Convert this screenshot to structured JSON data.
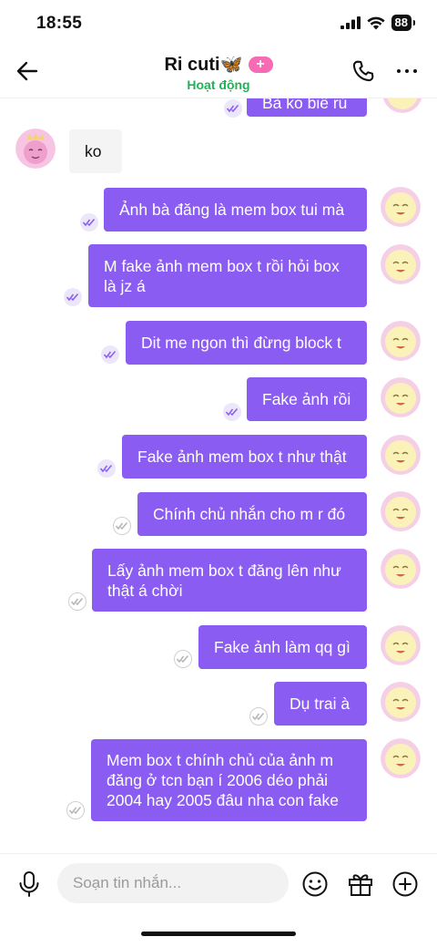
{
  "status_bar": {
    "time": "18:55",
    "battery": "88"
  },
  "header": {
    "title": "Ri cuti🦋",
    "plus_badge": "+",
    "status": "Hoạt động"
  },
  "colors": {
    "accent": "#8a5cf1",
    "online": "#20b257",
    "badge": "#f66bb4"
  },
  "messages": [
    {
      "side": "out",
      "text": "Bà ko biế rủ",
      "receipt": "seen"
    },
    {
      "side": "in",
      "text": "ko"
    },
    {
      "side": "out",
      "text": "Ảnh bà đăng là mem box tui mà",
      "receipt": "seen"
    },
    {
      "side": "out",
      "text": "M fake ảnh mem box t rồi hỏi box là jz á",
      "receipt": "seen"
    },
    {
      "side": "out",
      "text": "Dit me ngon thì đừng block t",
      "receipt": "seen"
    },
    {
      "side": "out",
      "text": "Fake ảnh rồi",
      "receipt": "seen"
    },
    {
      "side": "out",
      "text": "Fake ảnh mem box t như thật",
      "receipt": "seen"
    },
    {
      "side": "out",
      "text": "Chính chủ nhắn cho m r đó",
      "receipt": "sent"
    },
    {
      "side": "out",
      "text": "Lấy ảnh mem box t đăng lên như thật á chời",
      "receipt": "sent"
    },
    {
      "side": "out",
      "text": "Fake ảnh làm qq gì",
      "receipt": "sent"
    },
    {
      "side": "out",
      "text": "Dụ trai à",
      "receipt": "sent"
    },
    {
      "side": "out",
      "text": "Mem box t chính chủ của ảnh m đăng ở tcn bạn í 2006 déo phải 2004 hay 2005 đâu nha con fake",
      "receipt": "sent"
    }
  ],
  "composer": {
    "placeholder": "Soạn tin nhắn..."
  },
  "icons": [
    "back-arrow-icon",
    "phone-icon",
    "more-icon",
    "mic-icon",
    "emoji-icon",
    "gift-icon",
    "plus-circle-icon",
    "read-receipt-icon",
    "signal-icon",
    "wifi-icon"
  ]
}
